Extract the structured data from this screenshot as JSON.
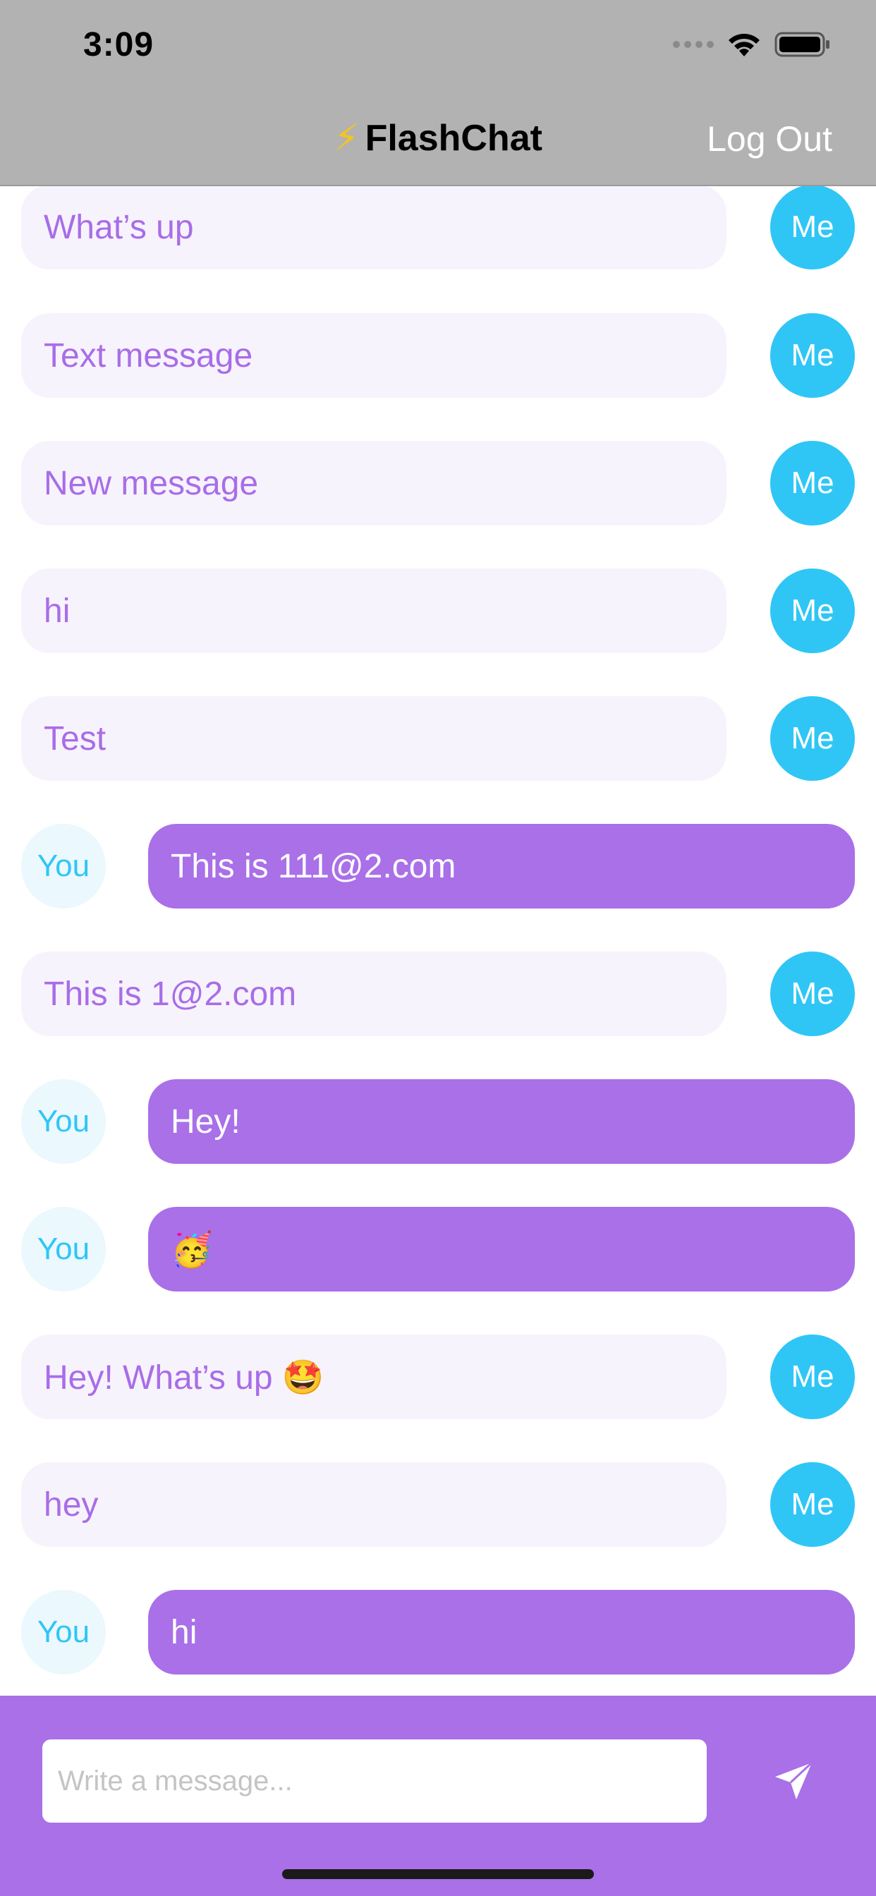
{
  "status_bar": {
    "time": "3:09"
  },
  "nav": {
    "bolt_icon": "⚡",
    "title": "FlashChat",
    "logout_label": "Log Out"
  },
  "messages": [
    {
      "sender": "me",
      "text": "What’s up",
      "avatar": "Me"
    },
    {
      "sender": "me",
      "text": "Text message",
      "avatar": "Me"
    },
    {
      "sender": "me",
      "text": "New message",
      "avatar": "Me"
    },
    {
      "sender": "me",
      "text": "hi",
      "avatar": "Me"
    },
    {
      "sender": "me",
      "text": "Test",
      "avatar": "Me"
    },
    {
      "sender": "you",
      "text": "This is 111@2.com",
      "avatar": "You"
    },
    {
      "sender": "me",
      "text": "This is 1@2.com",
      "avatar": "Me"
    },
    {
      "sender": "you",
      "text": "Hey!",
      "avatar": "You"
    },
    {
      "sender": "you",
      "text": "🥳",
      "avatar": "You"
    },
    {
      "sender": "me",
      "text": "Hey! What’s up 🤩",
      "avatar": "Me"
    },
    {
      "sender": "me",
      "text": "hey",
      "avatar": "Me"
    },
    {
      "sender": "you",
      "text": "hi",
      "avatar": "You"
    }
  ],
  "composer": {
    "placeholder": "Write a message...",
    "value": "",
    "send_icon": "paper-plane-icon"
  },
  "colors": {
    "accent_purple": "#a970e8",
    "accent_blue": "#2fc6f6",
    "nav_gray": "#b2b2b2"
  }
}
